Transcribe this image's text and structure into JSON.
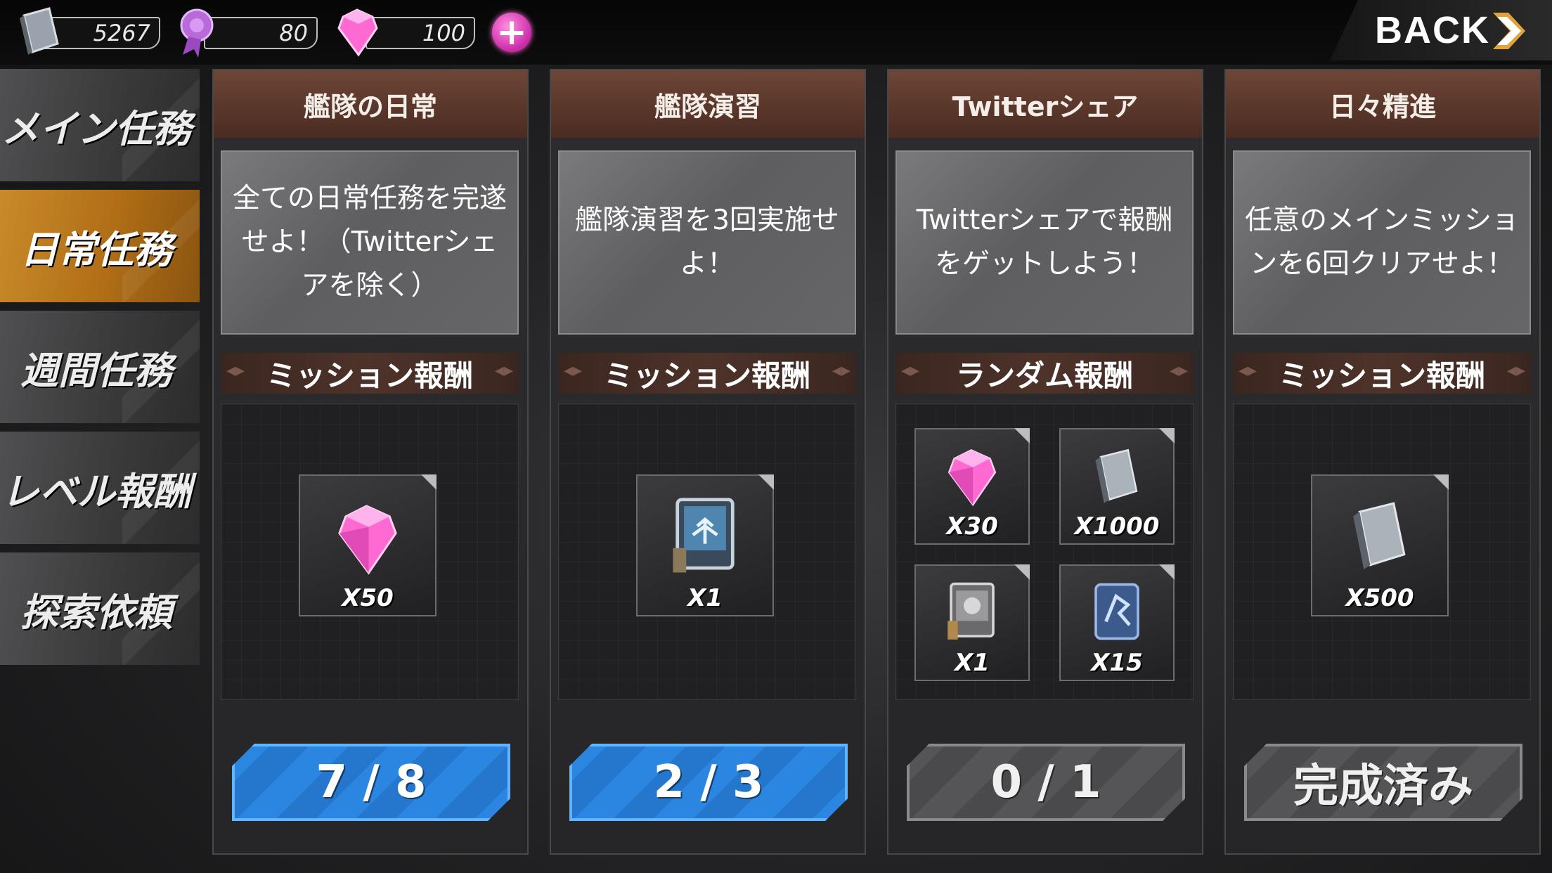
{
  "currencies": {
    "books": "5267",
    "medals": "80",
    "gems": "100"
  },
  "back_label": "BACK",
  "sidebar": {
    "items": [
      {
        "label": "メイン任務",
        "active": false
      },
      {
        "label": "日常任務",
        "active": true
      },
      {
        "label": "週間任務",
        "active": false
      },
      {
        "label": "レベル報酬",
        "active": false
      },
      {
        "label": "探索依頼",
        "active": false
      }
    ]
  },
  "colors": {
    "active_tab": "#c98a2a",
    "progress_blue": "#2a86e0",
    "card_header": "#6e4636",
    "gem": "#ff6ad2"
  },
  "missions": [
    {
      "title": "艦隊の日常",
      "description": "全ての日常任務を完遂せよ！（Twitterシェアを除く）",
      "reward_header": "ミッション報酬",
      "rewards": [
        {
          "icon": "gem-icon",
          "qty": "X50"
        }
      ],
      "progress": "7 / 8"
    },
    {
      "title": "艦隊演習",
      "description": "艦隊演習を3回実施せよ！",
      "reward_header": "ミッション報酬",
      "rewards": [
        {
          "icon": "blueprint-card-icon",
          "qty": "X1"
        }
      ],
      "progress": "2 / 3"
    },
    {
      "title": "Twitterシェア",
      "description": "Twitterシェアで報酬をゲットしよう！",
      "reward_header": "ランダム報酬",
      "rewards": [
        {
          "icon": "gem-icon",
          "qty": "X30"
        },
        {
          "icon": "book-icon",
          "qty": "X1000"
        },
        {
          "icon": "equipment-card-icon",
          "qty": "X1"
        },
        {
          "icon": "ship-chip-icon",
          "qty": "X15"
        }
      ],
      "progress": "0 / 1"
    },
    {
      "title": "日々精進",
      "description": "任意のメインミッションを6回クリアせよ！",
      "reward_header": "ミッション報酬",
      "rewards": [
        {
          "icon": "book-icon",
          "qty": "X500"
        }
      ],
      "progress": "完成済み"
    }
  ]
}
